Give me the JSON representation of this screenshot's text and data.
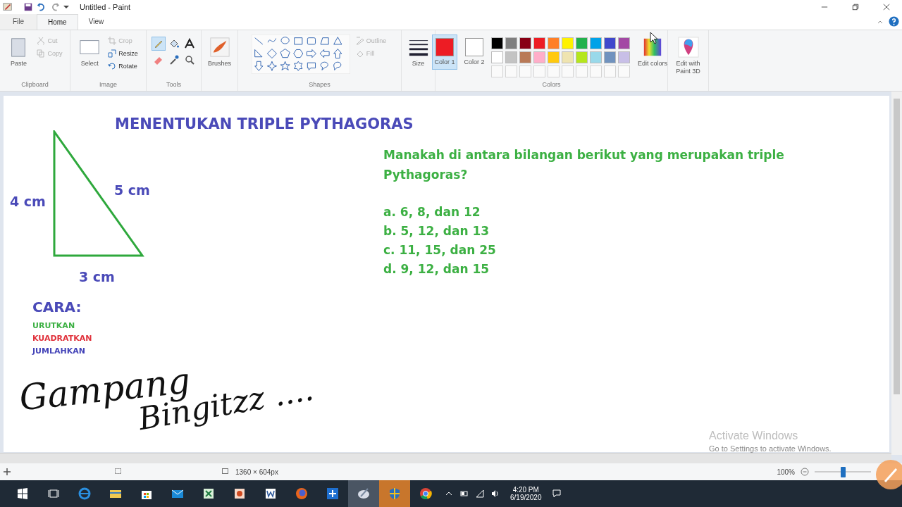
{
  "window": {
    "title": "Untitled - Paint"
  },
  "tabs": [
    {
      "label": "File",
      "kind": "file",
      "selected": false
    },
    {
      "label": "Home",
      "kind": "tab",
      "selected": true
    },
    {
      "label": "View",
      "kind": "tab",
      "selected": false
    }
  ],
  "ribbon": {
    "clipboard": {
      "label": "Clipboard",
      "paste": "Paste",
      "commands": [
        {
          "label": "Cut",
          "kind": "cut",
          "disabled": true
        },
        {
          "label": "Copy",
          "kind": "copy",
          "disabled": true
        }
      ]
    },
    "image": {
      "label": "Image",
      "select": "Select",
      "commands": [
        {
          "label": "Crop",
          "kind": "crop",
          "disabled": true
        },
        {
          "label": "Resize",
          "kind": "resize",
          "disabled": false
        },
        {
          "label": "Rotate",
          "kind": "rotate",
          "disabled": false
        }
      ]
    },
    "tools": {
      "label": "Tools"
    },
    "brushes": "Brushes",
    "shapes": {
      "label": "Shapes",
      "commands": [
        {
          "label": "Outline",
          "kind": "outline",
          "disabled": true
        },
        {
          "label": "Fill",
          "kind": "fill",
          "disabled": true
        }
      ]
    },
    "size": "Size",
    "colors": {
      "label": "Colors",
      "slots": [
        {
          "label": "Color 1",
          "color": "#ed1c24",
          "selected": true
        },
        {
          "label": "Color 2",
          "color": "#ffffff",
          "selected": false
        }
      ],
      "palette": [
        {
          "color": "#000000"
        },
        {
          "color": "#7f7f7f"
        },
        {
          "color": "#880015"
        },
        {
          "color": "#ed1c24"
        },
        {
          "color": "#ff7f27"
        },
        {
          "color": "#fff200"
        },
        {
          "color": "#22b14c"
        },
        {
          "color": "#00a2e8"
        },
        {
          "color": "#3f48cc"
        },
        {
          "color": "#a349a4"
        },
        {
          "color": "#ffffff"
        },
        {
          "color": "#c3c3c3"
        },
        {
          "color": "#b97a57"
        },
        {
          "color": "#ffaec9"
        },
        {
          "color": "#ffc90e"
        },
        {
          "color": "#efe4b0"
        },
        {
          "color": "#b5e61d"
        },
        {
          "color": "#99d9ea"
        },
        {
          "color": "#7092be"
        },
        {
          "color": "#c8bfe7"
        }
      ],
      "edit_colors": "Edit colors"
    },
    "paint3d": "Edit with Paint 3D"
  },
  "canvas": {
    "title": "MENENTUKAN TRIPLE PYTHAGORAS",
    "triangle": {
      "left": "4 cm",
      "hypotenuse": "5 cm",
      "bottom": "3 cm"
    },
    "method_heading": "CARA:",
    "steps": [
      {
        "text": "URUTKAN",
        "color": "#3cb043"
      },
      {
        "text": "KUADRATKAN",
        "color": "#e0303a"
      },
      {
        "text": "JUMLAHKAN",
        "color": "#4343b8"
      }
    ],
    "question": "Manakah di antara bilangan berikut yang merupakan triple Pythagoras?",
    "options": [
      "a. 6, 8, dan 12",
      "b. 5, 12, dan 13",
      "c. 11, 15, dan 25",
      "d. 9, 12, dan 15"
    ],
    "handwriting": [
      "Gampang",
      "Bingitzz ...."
    ],
    "activation": [
      "Activate Windows",
      "Go to Settings to activate Windows."
    ]
  },
  "status_bar": {
    "size": "1360 × 604px",
    "zoom": "100%",
    "zoom_slider": {
      "level": 0.5
    }
  },
  "taskbar": {
    "time": "4:20 PM",
    "date": "6/19/2020"
  }
}
